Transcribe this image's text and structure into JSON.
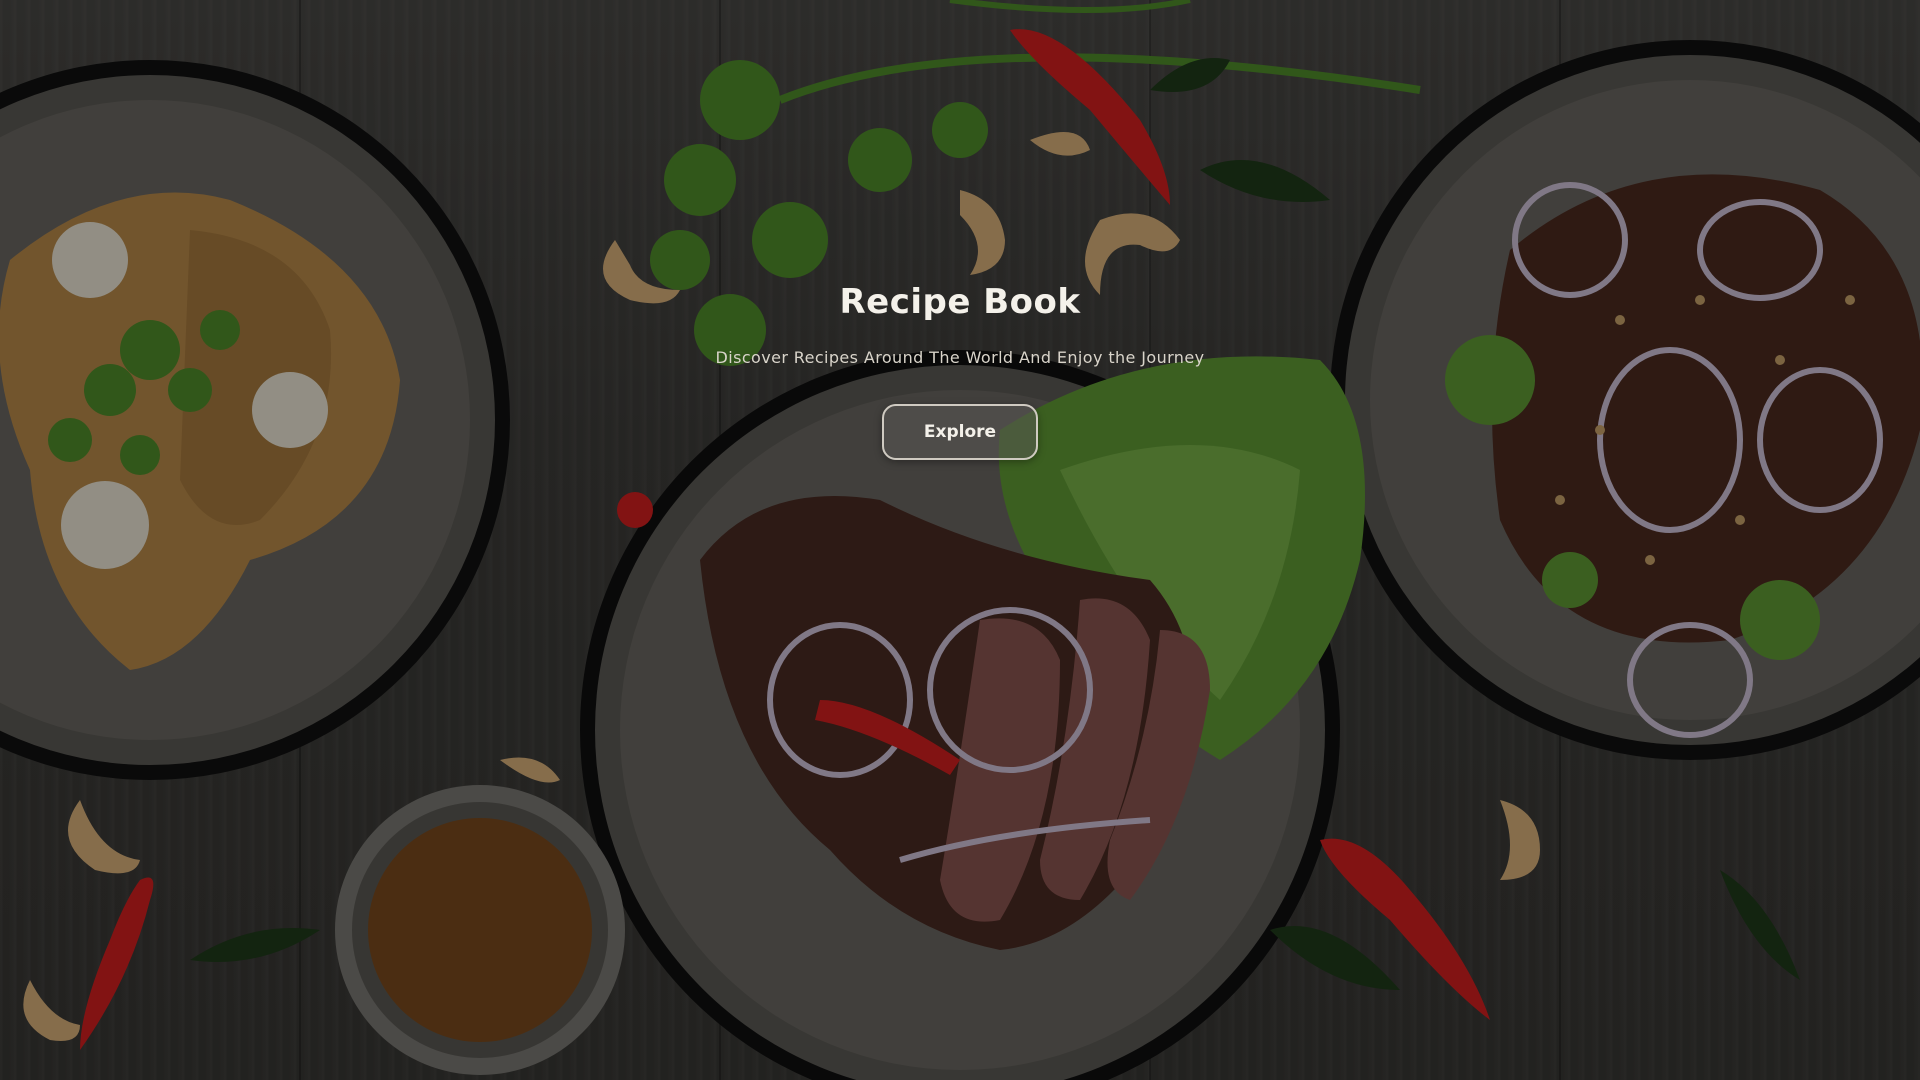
{
  "hero": {
    "title": "Recipe Book",
    "subtitle": "Discover Recipes Around The World And Enjoy the Journey",
    "explore_label": "Explore"
  },
  "colors": {
    "background_wood": "#3f3e3b",
    "overlay": "rgba(0,0,0,0.38)",
    "text": "#f4f1ea",
    "button_border": "#cfcac1"
  }
}
